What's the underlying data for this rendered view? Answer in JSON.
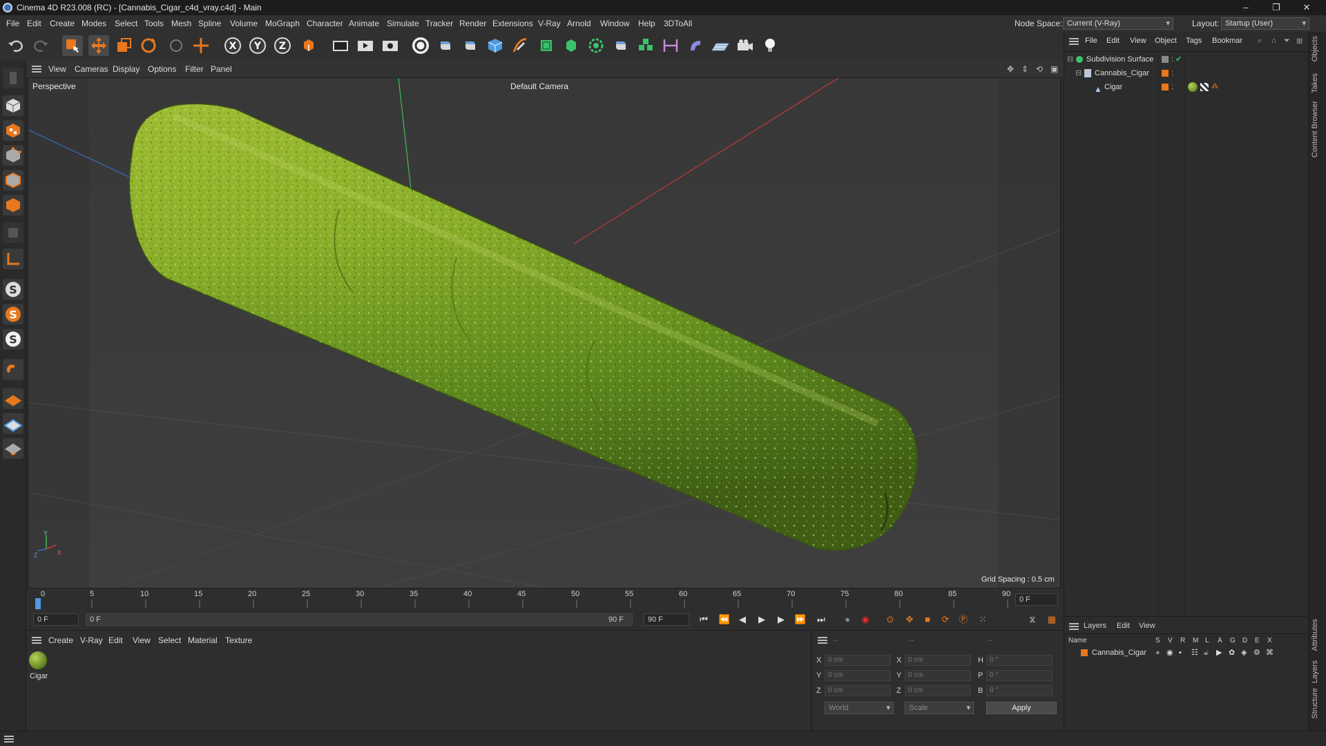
{
  "window": {
    "title": "Cinema 4D R23.008 (RC) - [Cannabis_Cigar_c4d_vray.c4d] - Main",
    "minimize": "–",
    "restore": "❐",
    "close": "✕"
  },
  "menubar": {
    "items": [
      "File",
      "Edit",
      "Create",
      "Modes",
      "Select",
      "Tools",
      "Mesh",
      "Spline",
      "Volume",
      "MoGraph",
      "Character",
      "Animate",
      "Simulate",
      "Tracker",
      "Render",
      "Extensions",
      "V-Ray",
      "Arnold",
      "Window",
      "Help",
      "3DToAll"
    ],
    "node_space_label": "Node Space:",
    "node_space_value": "Current (V-Ray)",
    "layout_label": "Layout:",
    "layout_value": "Startup (User)"
  },
  "viewport": {
    "menu": [
      "View",
      "Cameras",
      "Display",
      "Options",
      "Filter",
      "Panel"
    ],
    "view_name": "Perspective",
    "camera": "Default Camera",
    "grid_spacing": "Grid Spacing : 0.5 cm",
    "axis_z": "Z",
    "axis_y": "Y",
    "axis_x": "X"
  },
  "timeline": {
    "ticks": [
      "0",
      "5",
      "10",
      "15",
      "20",
      "25",
      "30",
      "35",
      "40",
      "45",
      "50",
      "55",
      "60",
      "65",
      "70",
      "75",
      "80",
      "85",
      "90"
    ],
    "current_frame_right": "0 F",
    "start_frame": "0 F",
    "range_start": "0 F",
    "range_end": "90 F",
    "end_frame": "90 F"
  },
  "material_panel": {
    "menu": [
      "Create",
      "V-Ray",
      "Edit",
      "View",
      "Select",
      "Material",
      "Texture"
    ],
    "material_name": "Cigar"
  },
  "coord_panel": {
    "header": [
      "--",
      "--",
      "--"
    ],
    "rows": [
      {
        "a": "X",
        "av": "0 cm",
        "b": "X",
        "bv": "0 cm",
        "c": "H",
        "cv": "0 °"
      },
      {
        "a": "Y",
        "av": "0 cm",
        "b": "Y",
        "bv": "0 cm",
        "c": "P",
        "cv": "0 °"
      },
      {
        "a": "Z",
        "av": "0 cm",
        "b": "Z",
        "bv": "0 cm",
        "c": "B",
        "cv": "0 °"
      }
    ],
    "space": "World",
    "mode": "Scale",
    "apply": "Apply"
  },
  "object_panel": {
    "menu": [
      "File",
      "Edit",
      "View",
      "Object",
      "Tags",
      "Bookmar"
    ],
    "objects": [
      {
        "name": "Subdivision Surface",
        "level": 0
      },
      {
        "name": "Cannabis_Cigar",
        "level": 1
      },
      {
        "name": "Cigar",
        "level": 2
      }
    ]
  },
  "layer_panel": {
    "menu": [
      "Layers",
      "Edit",
      "View"
    ],
    "columns": [
      "Name",
      "S",
      "V",
      "R",
      "M",
      "L",
      "A",
      "G",
      "D",
      "E",
      "X"
    ],
    "layer_name": "Cannabis_Cigar"
  },
  "right_tabs": [
    "Objects",
    "Takes",
    "Content Browser",
    "Attributes",
    "Layers",
    "Structure"
  ],
  "colors": {
    "accent_orange": "#e8781e",
    "axis_x": "#c23a3a",
    "axis_y": "#3fbf5a",
    "axis_z": "#3a6fc2",
    "cigar_green": "#7fa82a"
  }
}
